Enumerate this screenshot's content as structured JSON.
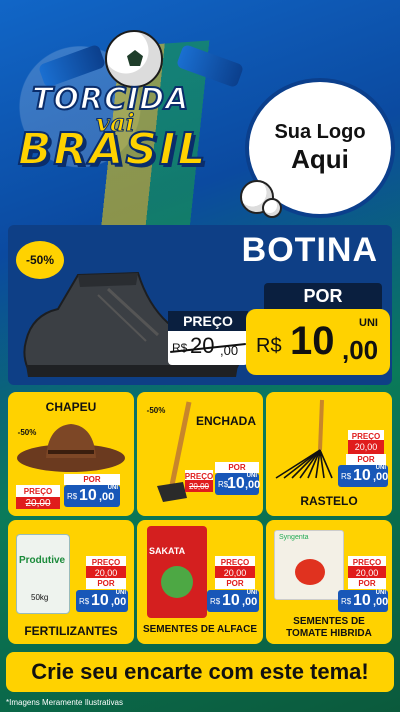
{
  "header": {
    "title_line1": "TORCIDA",
    "title_line2": "vai",
    "title_line3": "BRASIL",
    "brand_placeholder_line1": "Sua Logo",
    "brand_placeholder_line2": "Aqui"
  },
  "featured": {
    "discount": "-50%",
    "name": "BOTINA",
    "old_label": "PREÇO",
    "old_currency": "R$",
    "old_value": "20",
    "old_cents": ",00",
    "new_label": "POR",
    "currency": "R$",
    "value": "10",
    "cents": ",00",
    "unit": "UNI"
  },
  "products": [
    {
      "name": "CHAPEU",
      "discount": "-50%",
      "old": "20,00",
      "price_label": "POR",
      "currency": "R$",
      "value": "10",
      "cents": ",00",
      "unit": "UNI",
      "preco_label": "PREÇO"
    },
    {
      "name": "ENCHADA",
      "discount": "-50%",
      "old": "20,00",
      "price_label": "POR",
      "currency": "R$",
      "value": "10",
      "cents": ",00",
      "unit": "UNI",
      "preco_label": "PREÇO"
    },
    {
      "name": "RASTELO",
      "old": "20,00",
      "price_label": "POR",
      "currency": "R$",
      "value": "10",
      "cents": ",00",
      "unit": "UNI",
      "preco_label": "PREÇO"
    },
    {
      "name": "FERTILIZANTES",
      "old": "20,00",
      "price_label": "POR",
      "currency": "R$",
      "value": "10",
      "cents": ",00",
      "unit": "UNI",
      "preco_label": "PREÇO",
      "package_label": "Produtive",
      "package_weight": "50kg"
    },
    {
      "name": "SEMENTES DE ALFACE",
      "old": "20,00",
      "price_label": "POR",
      "currency": "R$",
      "value": "10",
      "cents": ",00",
      "unit": "UNI",
      "preco_label": "PREÇO",
      "package_label": "SAKATA"
    },
    {
      "name": "SEMENTES DE TOMATE HIBRIDA",
      "old": "20,00",
      "price_label": "POR",
      "currency": "R$",
      "value": "10",
      "cents": ",00",
      "unit": "UNI",
      "preco_label": "PREÇO",
      "package_label": "Syngenta"
    }
  ],
  "cta": {
    "label": "Crie seu encarte com este tema!"
  },
  "disclaimer": "*Imagens Meramente Ilustrativas",
  "colors": {
    "yellow": "#ffd200",
    "blue": "#1857b8",
    "red": "#e01c1c",
    "navy": "#0e3f86"
  }
}
